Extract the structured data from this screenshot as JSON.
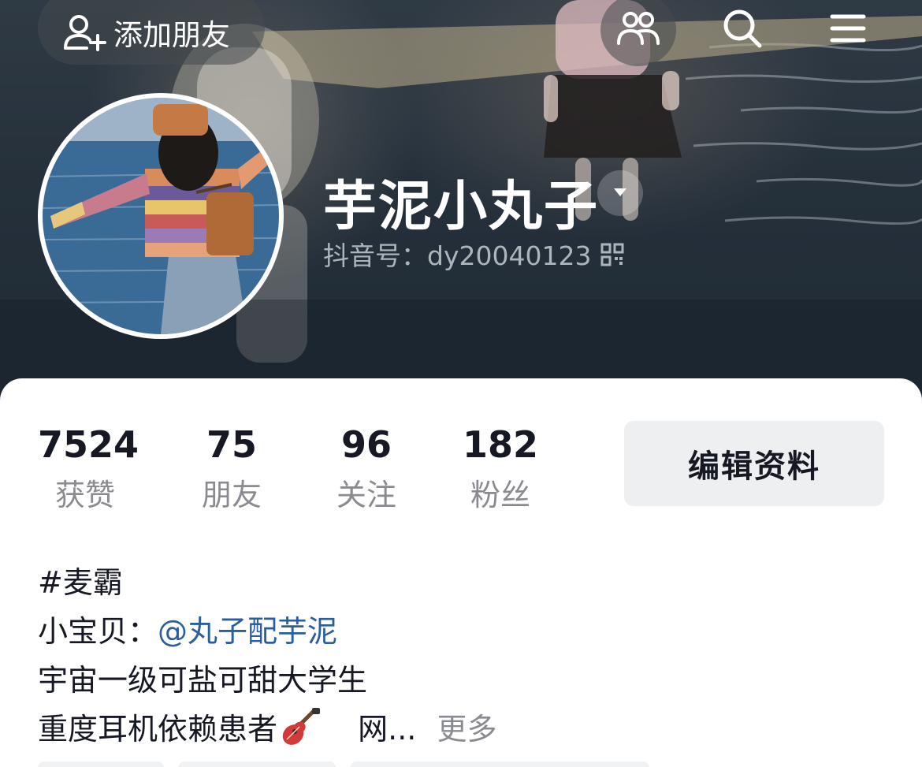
{
  "header": {
    "add_friend_label": "添加朋友",
    "icons": [
      "add-user-icon",
      "friends-icon",
      "search-icon",
      "menu-icon"
    ]
  },
  "profile": {
    "nickname": "芋泥小丸子",
    "douyin_id": "抖音号：dy20040123"
  },
  "stats": [
    {
      "value": "7524",
      "label": "获赞"
    },
    {
      "value": "75",
      "label": "朋友"
    },
    {
      "value": "96",
      "label": "关注"
    },
    {
      "value": "182",
      "label": "粉丝"
    }
  ],
  "edit_profile_label": "编辑资料",
  "bio": {
    "line1": "#麦霸",
    "line2_prefix": "小宝贝：",
    "line2_mention": "@丸子配芋泥",
    "line3": "宇宙一级可盐可甜大学生",
    "line4_text": "重度耳机依赖患者",
    "line4_suffix": "网...",
    "more_label": "更多"
  },
  "colors": {
    "text_primary": "#161823",
    "text_secondary": "#8a8b91",
    "mention": "#2a5e9e",
    "button_bg": "#eeeff1",
    "cover_bg": "#25303b"
  }
}
